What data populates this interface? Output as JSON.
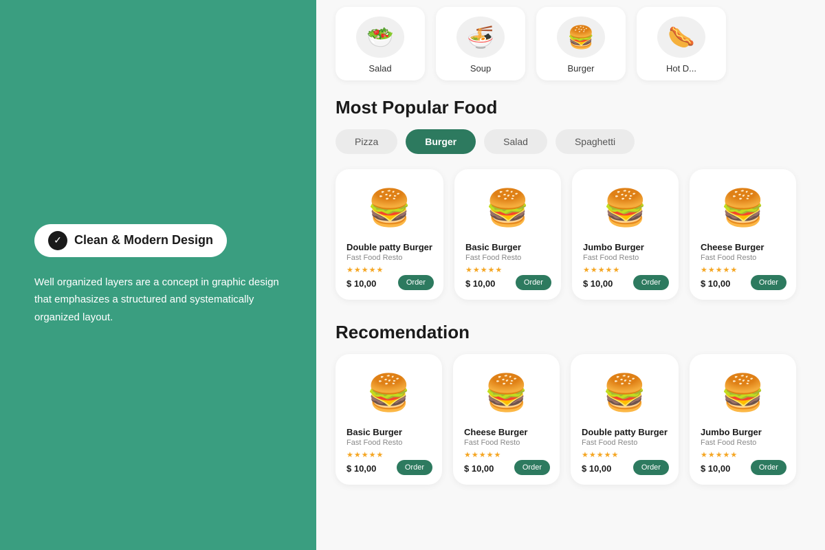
{
  "leftPanel": {
    "badge": {
      "checkmark": "✓",
      "label": "Clean & Modern Design"
    },
    "description": "Well organized layers are a concept in graphic design that emphasizes a structured and systematically organized layout."
  },
  "rightPanel": {
    "categories": [
      {
        "emoji": "🥗",
        "label": "Salad"
      },
      {
        "emoji": "🍜",
        "label": "Soup"
      },
      {
        "emoji": "🍔",
        "label": "Burger"
      },
      {
        "emoji": "🌭",
        "label": "Hot D..."
      }
    ],
    "popularSection": {
      "title": "Most Popular Food",
      "filters": [
        {
          "label": "Pizza",
          "active": false
        },
        {
          "label": "Burger",
          "active": true
        },
        {
          "label": "Salad",
          "active": false
        },
        {
          "label": "Spaghetti",
          "active": false
        }
      ],
      "items": [
        {
          "name": "Double patty Burger",
          "resto": "Fast Food Resto",
          "stars": "★★★★★",
          "price": "$ 10,00",
          "emoji": "🍔"
        },
        {
          "name": "Basic Burger",
          "resto": "Fast Food Resto",
          "stars": "★★★★★",
          "price": "$ 10,00",
          "emoji": "🍔"
        },
        {
          "name": "Jumbo Burger",
          "resto": "Fast Food Resto",
          "stars": "★★★★★",
          "price": "$ 10,00",
          "emoji": "🍔"
        },
        {
          "name": "Cheese Burger",
          "resto": "Fast Food Resto",
          "stars": "★★★★★",
          "price": "$ 10,00",
          "emoji": "🍔"
        }
      ]
    },
    "recomSection": {
      "title": "Recomendation",
      "items": [
        {
          "name": "Basic Burger",
          "resto": "Fast Food Resto",
          "stars": "★★★★★",
          "price": "$ 10,00",
          "emoji": "🍔"
        },
        {
          "name": "Cheese Burger",
          "resto": "Fast Food Resto",
          "stars": "★★★★★",
          "price": "$ 10,00",
          "emoji": "🍔"
        },
        {
          "name": "Double patty Burger",
          "resto": "Fast Food Resto",
          "stars": "★★★★★",
          "price": "$ 10,00",
          "emoji": "🍔"
        },
        {
          "name": "Jumbo Burger",
          "resto": "Fast Food Resto",
          "stars": "★★★★★",
          "price": "$ 10,00",
          "emoji": "🍔"
        }
      ]
    },
    "orderLabel": "Order"
  }
}
